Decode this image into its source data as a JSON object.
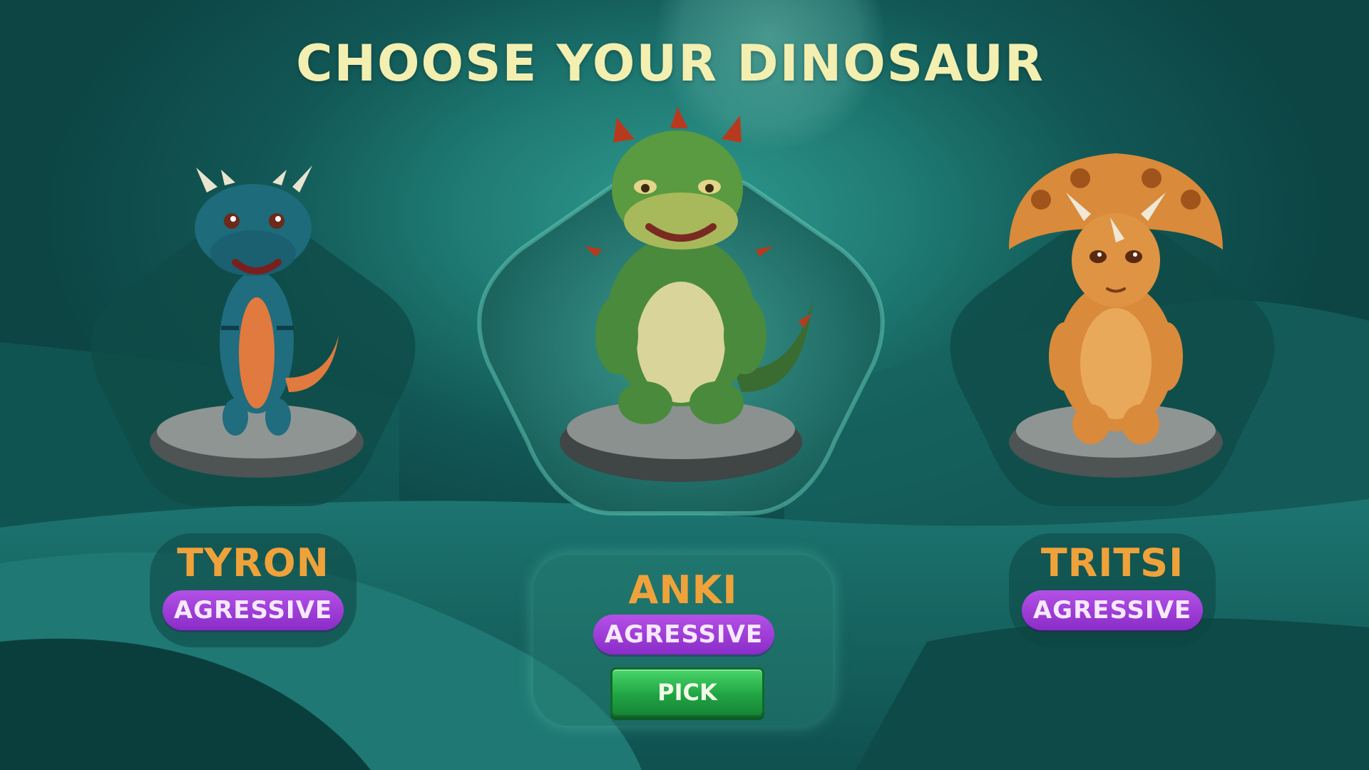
{
  "screen": {
    "title": "CHOOSE YOUR DINOSAUR"
  },
  "characters": [
    {
      "name": "TYRON",
      "trait": "AGRESSIVE",
      "selected": false,
      "species_icon": "blue-dragon-icon",
      "body_color": "#1f6d7e",
      "belly_color": "#e07a3e"
    },
    {
      "name": "ANKI",
      "trait": "AGRESSIVE",
      "selected": true,
      "species_icon": "green-dinosaur-icon",
      "body_color": "#4a8a3c",
      "belly_color": "#d9d49a"
    },
    {
      "name": "TRITSI",
      "trait": "AGRESSIVE",
      "selected": false,
      "species_icon": "triceratops-icon",
      "body_color": "#d98a3a",
      "belly_color": "#e8a95a"
    }
  ],
  "actions": {
    "pick_label": "PICK"
  },
  "colors": {
    "title": "#f3efb0",
    "name": "#f0a23a",
    "badge": "#a043d8",
    "pick": "#27b14a"
  }
}
